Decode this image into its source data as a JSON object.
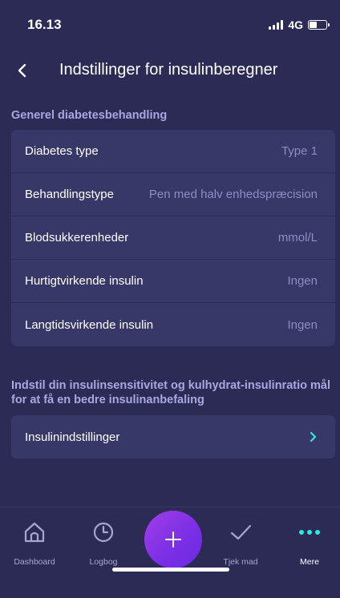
{
  "status": {
    "time": "16.13",
    "network": "4G"
  },
  "header": {
    "title": "Indstillinger for insulinberegner"
  },
  "section1": {
    "title": "Generel diabetesbehandling",
    "rows": [
      {
        "label": "Diabetes type",
        "value": "Type 1"
      },
      {
        "label": "Behandlingstype",
        "value": "Pen med halv enhedspræcision"
      },
      {
        "label": "Blodsukkerenheder",
        "value": "mmol/L"
      },
      {
        "label": "Hurtigtvirkende insulin",
        "value": "Ingen"
      },
      {
        "label": "Langtidsvirkende insulin",
        "value": "Ingen"
      }
    ]
  },
  "section2": {
    "title": "Indstil din insulinsensitivitet og kulhydrat-insulinratio mål for at få en bedre insulinanbefaling",
    "rows": [
      {
        "label": "Insulinindstillinger"
      }
    ]
  },
  "tabs": [
    {
      "label": "Dashboard",
      "icon": "home-icon"
    },
    {
      "label": "Logbog",
      "icon": "clock-icon"
    },
    {
      "label": "Tjek mad",
      "icon": "checkmark-icon"
    },
    {
      "label": "Mere",
      "icon": "more-dots-icon"
    }
  ],
  "colors": {
    "background": "#2b2b55",
    "card": "#373768",
    "accent_cyan": "#2ee6e6",
    "fab_purple": "#8a33e8",
    "section_title": "#a9a7e0"
  }
}
